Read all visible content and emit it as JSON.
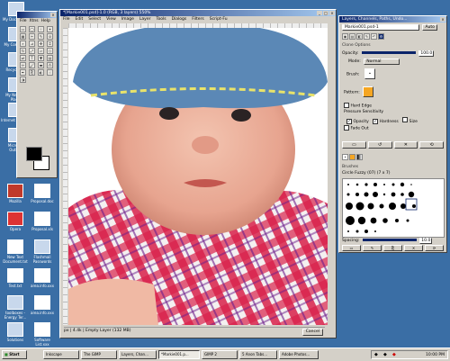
{
  "desktop": {
    "icons": [
      {
        "label": "My Documents"
      },
      {
        "label": "My Computer"
      },
      {
        "label": "Recycle Bin"
      },
      {
        "label": "My Network Places"
      },
      {
        "label": "Internet Explorer"
      },
      {
        "label": "Microsoft Outlook"
      },
      {
        "label": "Mozilla"
      },
      {
        "label": "Proposal.doc"
      },
      {
        "label": "Opera"
      },
      {
        "label": "Proposal.xls"
      },
      {
        "label": "New Text Document.txt"
      },
      {
        "label": "Flashmail Passwords"
      },
      {
        "label": "Test.txt"
      },
      {
        "label": "area.info.xxx"
      },
      {
        "label": "toolboxes - Energy Ter..."
      },
      {
        "label": "area.info.xxx"
      },
      {
        "label": "Solutions"
      },
      {
        "label": "Software List.xxx"
      }
    ]
  },
  "toolbox": {
    "menus": [
      "File",
      "Xtns",
      "Help"
    ]
  },
  "image_window": {
    "title": "*[Markie001.psd]-1.0 (RGB, 3 layers) 550%",
    "menus": [
      "File",
      "Edit",
      "Select",
      "View",
      "Image",
      "Layer",
      "Tools",
      "Dialogs",
      "Filters",
      "Script-Fu"
    ],
    "status": "px | 4.4k | Empty Layer (132 MB)",
    "cancel_label": "Cancel"
  },
  "layers_dialog": {
    "title": "Layers, Channels, Paths, Undo...",
    "image_select": "Markie001.psd-1",
    "auto_label": "Auto",
    "tool_options_label": "Clone Options",
    "opacity_label": "Opacity:",
    "opacity_value": "100.0",
    "mode_label": "Mode:",
    "mode_value": "Normal",
    "brush_label": "Brush:",
    "pattern_label": "Pattern:",
    "hard_edge_label": "Hard Edge",
    "pressure_label": "Pressure Sensitivity",
    "pressure_options": [
      "Opacity",
      "Hardness",
      "Size"
    ],
    "fade_out_label": "Fade Out",
    "brushes_label": "Brushes",
    "brush_name": "Circle Fuzzy (07) (7 x 7)",
    "spacing_label": "Spacing:",
    "spacing_value": "10.0"
  },
  "taskbar": {
    "start_label": "Start",
    "tasks": [
      "Inkscape",
      "The GIMP",
      "Layers, Chan...",
      "*Markie001.p...",
      "GIMP 2",
      "5 Anon Tabs...",
      "Adobe Photos..."
    ],
    "clock": "10:00 PM"
  },
  "colors": {
    "desktop_bg": "#3a6ea5",
    "titlebar": "#0a246a",
    "fg_color": "#000000",
    "bg_color": "#ffffff",
    "pattern_color": "#f5a623"
  }
}
